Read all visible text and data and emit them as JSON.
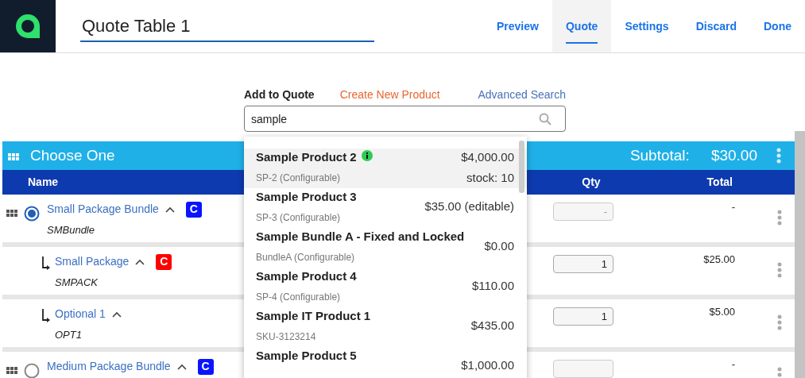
{
  "header": {
    "title": "Quote Table 1",
    "tabs": [
      {
        "label": "Preview",
        "selected": false
      },
      {
        "label": "Quote",
        "selected": true
      },
      {
        "label": "Settings",
        "selected": false
      },
      {
        "label": "Discard",
        "selected": false
      },
      {
        "label": "Done",
        "selected": false
      }
    ]
  },
  "add_to_quote": {
    "label": "Add to Quote",
    "create_link": "Create New Product",
    "advanced_link": "Advanced Search",
    "search_value": "sample"
  },
  "group": {
    "title": "Choose One",
    "subtotal_label": "Subtotal:",
    "subtotal": "$30.00"
  },
  "table": {
    "columns": [
      "Name",
      "Qty",
      "Total"
    ],
    "rows": [
      {
        "name": "Small Package Bundle",
        "code": "SMBundle",
        "expanded": true,
        "badge": "C",
        "color": "#0a14ff",
        "selected": true,
        "qty": "-",
        "qty_disabled": true,
        "total": "-",
        "children": [
          {
            "name": "Small Package",
            "code": "SMPACK",
            "expanded": true,
            "badge": "C",
            "color": "#ff0000",
            "qty": "1",
            "qty_disabled": false,
            "total": "$25.00"
          },
          {
            "name": "Optional 1",
            "code": "OPT1",
            "expanded": true,
            "qty": "1",
            "qty_disabled": false,
            "total": "$5.00"
          }
        ]
      },
      {
        "name": "Medium Package Bundle",
        "expanded": true,
        "badge": "C",
        "color": "#0a14ff",
        "selected": false,
        "qty_disabled": true,
        "total": "-"
      }
    ]
  },
  "dropdown": {
    "items": [
      {
        "name": "Sample Product 2",
        "info": true,
        "code": "SP-2 (Configurable)",
        "price": "$4,000.00",
        "stock": "stock: 10",
        "selected": true
      },
      {
        "name": "Sample Product 3",
        "info": false,
        "code": "SP-3 (Configurable)",
        "price": "$35.00 (editable)",
        "selected": false
      },
      {
        "name": "Sample Bundle A - Fixed and Locked",
        "info": false,
        "code": "BundleA (Configurable)",
        "price": "$0.00",
        "selected": false
      },
      {
        "name": "Sample Product 4",
        "info": false,
        "code": "SP-4 (Configurable)",
        "price": "$110.00",
        "selected": false
      },
      {
        "name": "Sample IT Product 1",
        "info": false,
        "code": "SKU-3123214",
        "price": "$435.00",
        "selected": false
      },
      {
        "name": "Sample Product 5",
        "info": false,
        "price": "$1,000.00",
        "selected": false
      }
    ]
  }
}
